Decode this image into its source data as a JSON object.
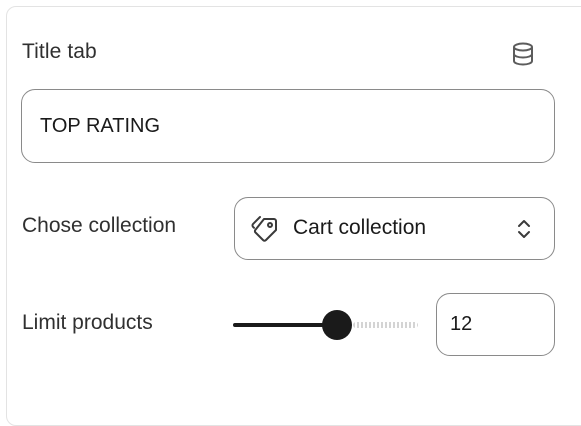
{
  "title_tab": {
    "label": "Title tab",
    "value": "TOP RATING",
    "icon": "database-icon"
  },
  "collection": {
    "label": "Chose collection",
    "selected": "Cart collection",
    "icon": "tag-icon",
    "chevron_icon": "select-arrows-icon"
  },
  "limit": {
    "label": "Limit products",
    "value": "12",
    "slider_fraction": 0.55
  },
  "colors": {
    "border": "#8a8a8a",
    "text": "#303030",
    "slider_active": "#1a1a1a",
    "slider_inactive": "#d4d4d4"
  }
}
